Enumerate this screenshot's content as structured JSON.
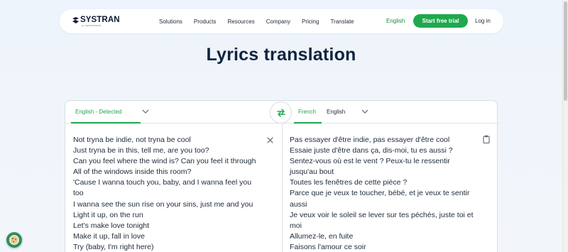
{
  "brand": {
    "name": "SYSTRAN",
    "sub": "by CHAPSVISION"
  },
  "nav": {
    "links": [
      "Solutions",
      "Products",
      "Resources",
      "Company",
      "Pricing",
      "Translate"
    ],
    "language": "English",
    "cta": "Start free trial",
    "login": "Log in"
  },
  "page": {
    "title": "Lyrics translation"
  },
  "translator": {
    "source_tab": "English - Detected",
    "target_tabs": [
      "French",
      "English"
    ],
    "source_lines": [
      "Not tryna be indie, not tryna be cool",
      "Just tryna be in this, tell me, are you too?",
      "Can you feel where the wind is? Can you feel it through",
      "All of the windows inside this room?",
      "'Cause I wanna touch you, baby, and I wanna feel you",
      "too",
      "I wanna see the sun rise on your sins, just me and you",
      "Light it up, on the run",
      "Let's make love tonight",
      "Make it up, fall in love",
      "Try (baby, I'm right here)"
    ],
    "target_lines": [
      "Pas essayer d'être indie, pas essayer d'être cool",
      "Essaie juste d'être dans ça, dis-moi, tu es aussi ?",
      "Sentez-vous où est le vent ? Peux-tu le ressentir",
      "jusqu'au bout",
      "Toutes les fenêtres de cette pièce ?",
      "Parce que je veux te toucher, bébé, et je veux te sentir",
      "aussi",
      "Je veux voir le soleil se lever sur tes péchés, juste toi et",
      "moi",
      "Allumez-le, en fuite",
      "Faisons l'amour ce soir"
    ]
  },
  "icons": {
    "swap": "swap-arrows-icon",
    "clear": "close-icon",
    "copy": "clipboard-icon",
    "cookie": "cookie-icon",
    "chevron": "chevron-down-icon"
  },
  "colors": {
    "accent": "#1fa84e",
    "title": "#10243d",
    "text": "#1e2a3a"
  }
}
